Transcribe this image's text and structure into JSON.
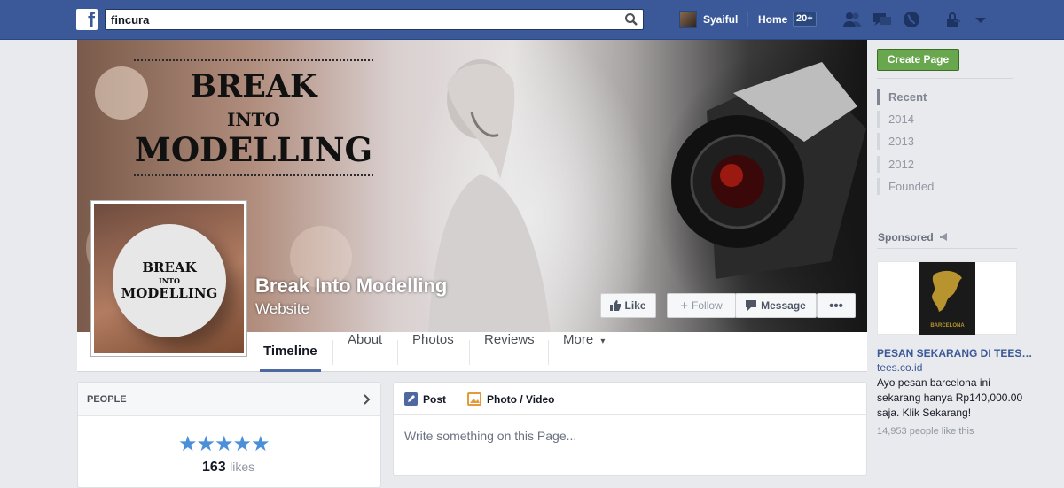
{
  "topbar": {
    "logo_letter": "f",
    "search_value": "fincura",
    "user_name": "Syaiful",
    "home_label": "Home",
    "notif_count": "20+"
  },
  "cover": {
    "title_line1": "BREAK",
    "title_line2": "INTO",
    "title_line3": "MODELLING",
    "page_name": "Break Into Modelling",
    "page_category": "Website",
    "like_button": "Like",
    "follow_button": "Follow",
    "message_button": "Message",
    "more_button": "•••"
  },
  "profile_pic": {
    "line1": "BREAK",
    "line2": "INTO",
    "line3": "MODELLING"
  },
  "tabs": {
    "timeline": "Timeline",
    "about": "About",
    "photos": "Photos",
    "reviews": "Reviews",
    "more": "More",
    "more_caret": "▾"
  },
  "sidebar": {
    "create_page": "Create Page",
    "years": [
      "Recent",
      "2014",
      "2013",
      "2012",
      "Founded"
    ],
    "sponsored_label": "Sponsored",
    "ad": {
      "shirt_text": "BARCELONA",
      "title": "PESAN SEKARANG DI TEES…",
      "domain": "tees.co.id",
      "body": "Ayo pesan barcelona ini sekarang hanya Rp140,000.00 saja. Klik Sekarang!",
      "likes": "14,953 people like this"
    }
  },
  "people": {
    "header": "PEOPLE",
    "stars": "★★★★★",
    "likes_count": "163",
    "likes_label": "likes"
  },
  "composer": {
    "post_tab": "Post",
    "photo_tab": "Photo / Video",
    "placeholder": "Write something on this Page..."
  },
  "colors": {
    "brand_blue": "#3b5998",
    "create_green": "#69a74e",
    "star_blue": "#4a8fd8"
  }
}
